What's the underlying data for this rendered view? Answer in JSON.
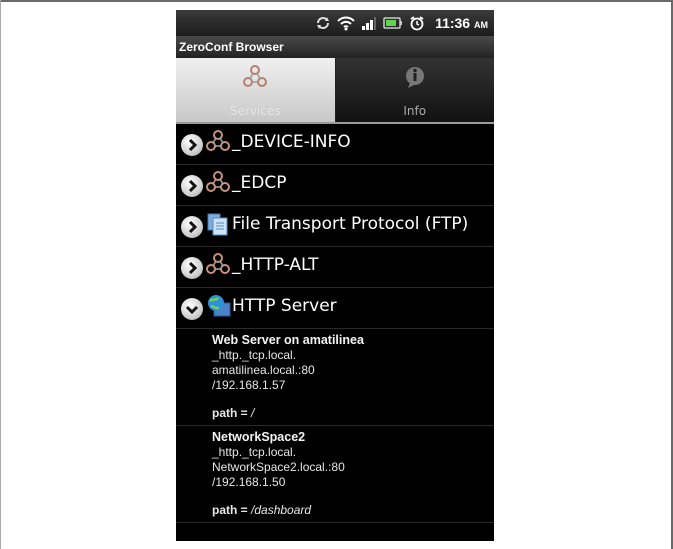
{
  "status_bar": {
    "time": "11:36",
    "ampm": "AM",
    "icons": [
      "sync-icon",
      "wifi-icon",
      "signal-icon",
      "battery-icon",
      "alarm-icon"
    ]
  },
  "app": {
    "title": "ZeroConf Browser"
  },
  "tabs": [
    {
      "label": "Services",
      "icon": "network-icon",
      "active": true
    },
    {
      "label": "Info",
      "icon": "info-icon",
      "active": false
    }
  ],
  "services": [
    {
      "label": "_DEVICE-INFO",
      "icon": "network-icon",
      "expanded": false
    },
    {
      "label": "_EDCP",
      "icon": "network-icon",
      "expanded": false
    },
    {
      "label": "File Transport Protocol (FTP)",
      "icon": "ftp-icon",
      "expanded": false
    },
    {
      "label": "_HTTP-ALT",
      "icon": "network-icon",
      "expanded": false
    },
    {
      "label": "HTTP Server",
      "icon": "globe-icon",
      "expanded": true
    }
  ],
  "http_entries": [
    {
      "name": "Web Server on amatilinea",
      "type": "_http._tcp.local.",
      "host": "amatilinea.local.:80",
      "ip": "/192.168.1.57",
      "path_key": "path = ",
      "path_value": "/"
    },
    {
      "name": "NetworkSpace2",
      "type": "_http._tcp.local.",
      "host": "NetworkSpace2.local.:80",
      "ip": "/192.168.1.50",
      "path_key": "path = ",
      "path_value": "/dashboard"
    }
  ],
  "colors": {
    "background": "#000000",
    "text": "#ffffff",
    "tab_active": "#e0e0e0"
  }
}
